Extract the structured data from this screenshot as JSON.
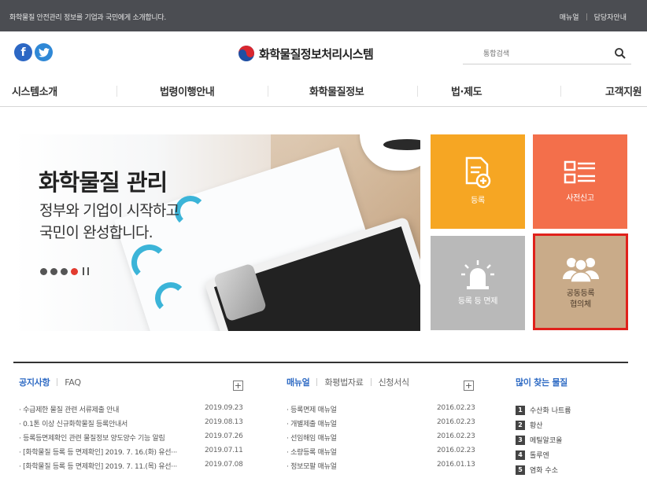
{
  "topbar": {
    "message": "화학물질 안전관리 정보를 기업과 국민에게 소개합니다.",
    "manual": "매뉴얼",
    "contact": "담당자안내"
  },
  "header": {
    "site_title": "화학물질정보처리시스템",
    "search_placeholder": "통합검색",
    "sns": {
      "facebook": "f",
      "twitter": "t"
    }
  },
  "gnb": [
    "시스템소개",
    "법령이행안내",
    "화학물질정보",
    "법·제도",
    "고객지원"
  ],
  "hero": {
    "headline": "화학물질 관리",
    "line1": "정부와 기업이 시작하고",
    "line2": "국민이 완성합니다.",
    "active_slide": 4,
    "slide_count": 4
  },
  "tiles": [
    {
      "label": "등록",
      "color": "#f6a623",
      "icon": "document-add-icon"
    },
    {
      "label": "사전신고",
      "color": "#f36f4b",
      "icon": "list-icon"
    },
    {
      "label": "등록 등 면제",
      "color": "#b9b9b9",
      "icon": "siren-icon"
    },
    {
      "label": "공동등록\n협의체",
      "color": "#c9ab89",
      "icon": "people-icon"
    }
  ],
  "notice": {
    "tabs": [
      "공지사항",
      "FAQ"
    ],
    "more": "+",
    "items": [
      {
        "title": "· 수급제한 물질 관련 서류제출 안내",
        "date": "2019.09.23"
      },
      {
        "title": "· 0.1톤 이상 신규화학물질 등록안내서",
        "date": "2019.08.13"
      },
      {
        "title": "· 등록등면제확인 관련 물질정보 양도양수 기능 알림",
        "date": "2019.07.26"
      },
      {
        "title": "· [화학물질 등록 등 면제확인] 2019. 7. 16.(화) 유선···",
        "date": "2019.07.11"
      },
      {
        "title": "· [화학물질 등록 등 면제확인] 2019. 7. 11.(목) 유선···",
        "date": "2019.07.08"
      }
    ]
  },
  "manual": {
    "tabs": [
      "매뉴얼",
      "화평법자료",
      "신청서식"
    ],
    "more": "+",
    "items": [
      {
        "title": "· 등록면제 매뉴얼",
        "date": "2016.02.23"
      },
      {
        "title": "· 개별제출 매뉴얼",
        "date": "2016.02.23"
      },
      {
        "title": "· 선임해임 매뉴얼",
        "date": "2016.02.23"
      },
      {
        "title": "· 소량등록 매뉴얼",
        "date": "2016.02.23"
      },
      {
        "title": "· 정보모팔 매뉴얼",
        "date": "2016.01.13"
      }
    ]
  },
  "popular": {
    "title": "많이 찾는 물질",
    "items": [
      {
        "rank": "1",
        "name": "수산화 나트륨"
      },
      {
        "rank": "2",
        "name": "황산"
      },
      {
        "rank": "3",
        "name": "메틸알코올"
      },
      {
        "rank": "4",
        "name": "톨루엔"
      },
      {
        "rank": "5",
        "name": "염화 수소"
      }
    ]
  }
}
